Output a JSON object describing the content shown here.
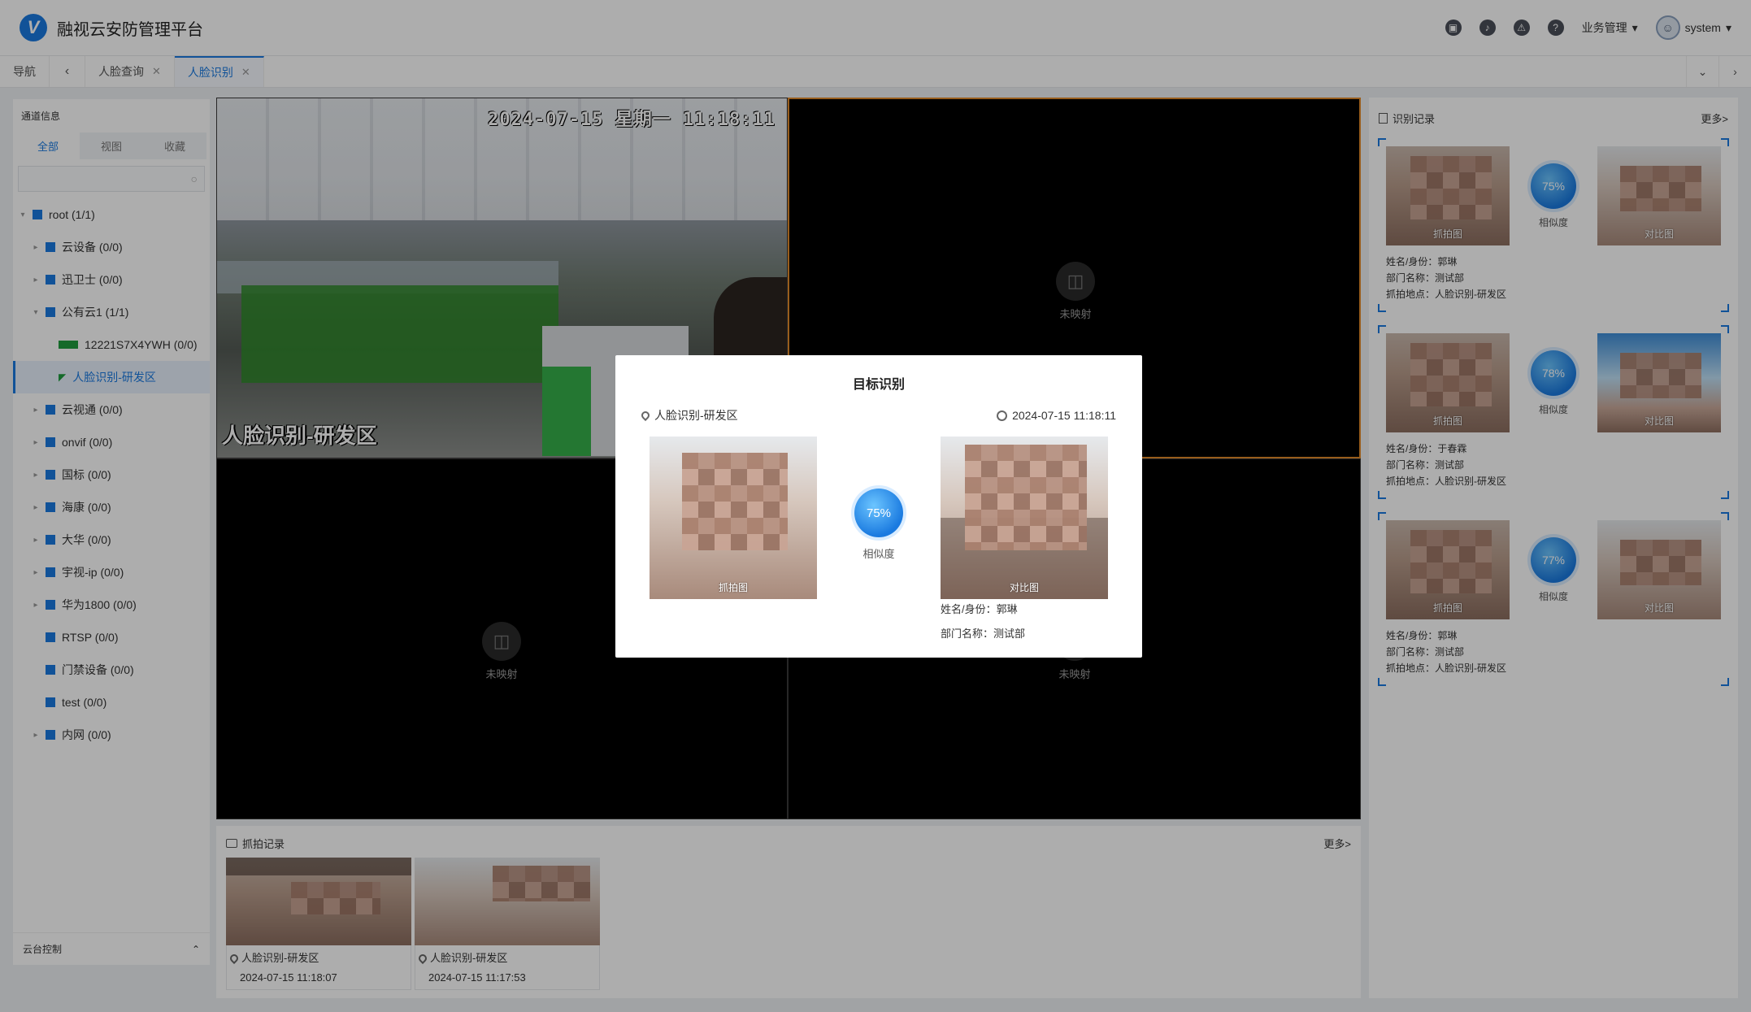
{
  "app": {
    "title": "融视云安防管理平台",
    "logo_letter": "V"
  },
  "header": {
    "icons": [
      "message-icon",
      "bell-icon",
      "alarm-icon",
      "help-icon"
    ],
    "business_menu": "业务管理",
    "user": "system"
  },
  "tabs": [
    {
      "label": "导航",
      "closable": false,
      "active": false
    },
    {
      "label": "人脸查询",
      "closable": true,
      "active": false
    },
    {
      "label": "人脸识别",
      "closable": true,
      "active": true
    }
  ],
  "sidebar": {
    "title": "通道信息",
    "tabs": [
      "全部",
      "视图",
      "收藏"
    ],
    "search_placeholder": "",
    "tree": [
      {
        "label": "root (1/1)",
        "level": 0,
        "expanded": true,
        "type": "node"
      },
      {
        "label": "云设备 (0/0)",
        "level": 1,
        "type": "node"
      },
      {
        "label": "迅卫士 (0/0)",
        "level": 1,
        "type": "node"
      },
      {
        "label": "公有云1 (1/1)",
        "level": 1,
        "expanded": true,
        "type": "node"
      },
      {
        "label": "12221S7X4YWH (0/0)",
        "level": 2,
        "type": "device"
      },
      {
        "label": "人脸识别-研发区",
        "level": 2,
        "type": "camera",
        "selected": true
      },
      {
        "label": "云视通 (0/0)",
        "level": 1,
        "type": "node"
      },
      {
        "label": "onvif (0/0)",
        "level": 1,
        "type": "node"
      },
      {
        "label": "国标 (0/0)",
        "level": 1,
        "type": "node"
      },
      {
        "label": "海康 (0/0)",
        "level": 1,
        "type": "node"
      },
      {
        "label": "大华 (0/0)",
        "level": 1,
        "type": "node"
      },
      {
        "label": "宇视-ip (0/0)",
        "level": 1,
        "type": "node"
      },
      {
        "label": "华为1800 (0/0)",
        "level": 1,
        "type": "node"
      },
      {
        "label": "RTSP (0/0)",
        "level": 1,
        "type": "leaf"
      },
      {
        "label": "门禁设备 (0/0)",
        "level": 1,
        "type": "leaf"
      },
      {
        "label": "test (0/0)",
        "level": 1,
        "type": "leaf"
      },
      {
        "label": "内网 (0/0)",
        "level": 1,
        "type": "node"
      }
    ],
    "footer": "云台控制"
  },
  "video": {
    "osd_time": "2024-07-15 星期一 11:18:11",
    "osd_name": "人脸识别-研发区",
    "unmapped_label": "未映射"
  },
  "capture": {
    "title": "抓拍记录",
    "more": "更多>",
    "items": [
      {
        "location": "人脸识别-研发区",
        "time": "2024-07-15 11:18:07"
      },
      {
        "location": "人脸识别-研发区",
        "time": "2024-07-15 11:17:53"
      }
    ]
  },
  "records": {
    "title": "识别记录",
    "more": "更多>",
    "capture_label": "抓拍图",
    "compare_label": "对比图",
    "similarity_label": "相似度",
    "name_prefix": "姓名/身份：",
    "dept_prefix": "部门名称：",
    "place_prefix": "抓拍地点：",
    "items": [
      {
        "similarity": "75%",
        "name": "郭琳",
        "dept": "测试部",
        "place": "人脸识别-研发区"
      },
      {
        "similarity": "78%",
        "name": "于春霖",
        "dept": "测试部",
        "place": "人脸识别-研发区"
      },
      {
        "similarity": "77%",
        "name": "郭琳",
        "dept": "测试部",
        "place": "人脸识别-研发区"
      }
    ]
  },
  "modal": {
    "title": "目标识别",
    "location": "人脸识别-研发区",
    "time": "2024-07-15 11:18:11",
    "capture_label": "抓拍图",
    "compare_label": "对比图",
    "similarity": "75%",
    "similarity_label": "相似度",
    "name_line": "姓名/身份：郭琳",
    "dept_line": "部门名称：测试部"
  },
  "colors": {
    "accent": "#1a7ae0",
    "active_border": "#e08a2a"
  }
}
